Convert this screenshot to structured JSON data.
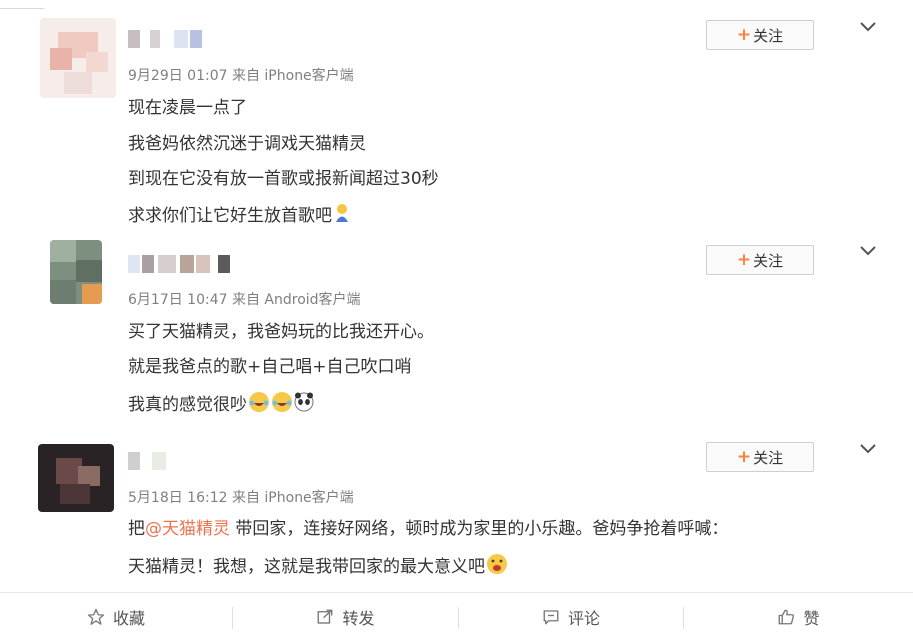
{
  "follow_label": "关注",
  "follow_plus": "+",
  "posts": [
    {
      "meta": "9月29日 01:07 来自 iPhone客户端",
      "lines": [
        "现在凌晨一点了",
        "我爸妈依然沉迷于调戏天猫精灵",
        "到现在它没有放一首歌或报新闻超过30秒",
        "求求你们让它好生放首歌吧"
      ],
      "emojis": [
        "praying-emoji"
      ]
    },
    {
      "meta": "6月17日 10:47 来自 Android客户端",
      "lines": [
        "买了天猫精灵，我爸妈玩的比我还开心。",
        "就是我爸点的歌+自己唱+自己吹口哨",
        "我真的感觉很吵"
      ],
      "emojis": [
        "laughing-crying-emoji",
        "laughing-crying-emoji",
        "panda-emoji"
      ]
    },
    {
      "meta": "5月18日 16:12 来自 iPhone客户端",
      "line1_prefix": "把",
      "mention": "@天猫精灵",
      "line1_suffix": " 带回家，连接好网络，顿时成为家里的小乐趣。爸妈争抢着呼喊：",
      "line2": "天猫精灵！我想，这就是我带回家的最大意义吧",
      "emojis": [
        "drooling-emoji"
      ]
    }
  ],
  "actions": {
    "favorite": "收藏",
    "repost": "转发",
    "comment": "评论",
    "like": "赞"
  },
  "colors": {
    "mention": "#eb7350",
    "follow_plus": "#ff8140",
    "meta": "#808080"
  }
}
